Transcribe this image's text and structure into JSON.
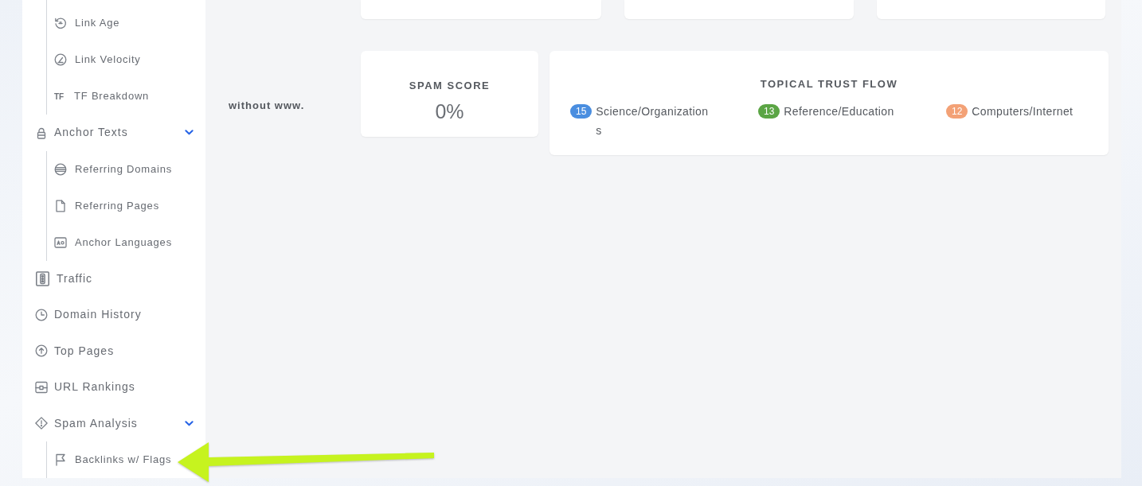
{
  "sidebar": {
    "continued_children": [
      {
        "label": "Link Age"
      },
      {
        "label": "Link Velocity"
      },
      {
        "label": "TF Breakdown",
        "icon_text": "TF"
      }
    ],
    "items": [
      {
        "label": "Anchor Texts",
        "expanded": true,
        "children": [
          {
            "label": "Referring Domains"
          },
          {
            "label": "Referring Pages"
          },
          {
            "label": "Anchor Languages"
          }
        ]
      },
      {
        "label": "Traffic"
      },
      {
        "label": "Domain History"
      },
      {
        "label": "Top Pages"
      },
      {
        "label": "URL Rankings"
      },
      {
        "label": "Spam Analysis",
        "expanded": true,
        "children": [
          {
            "label": "Backlinks w/ Flags"
          }
        ]
      }
    ]
  },
  "main": {
    "row_label": "without www.",
    "spam_score": {
      "title": "SPAM SCORE",
      "value": "0%"
    },
    "topical_trust_flow": {
      "title": "TOPICAL TRUST FLOW",
      "topics": [
        {
          "score": "15",
          "name": "Science/Organizations",
          "color": "#4a8ee0"
        },
        {
          "score": "13",
          "name": "Reference/Education",
          "color": "#5ba545"
        },
        {
          "score": "12",
          "name": "Computers/Internet",
          "color": "#f3a176"
        }
      ]
    }
  },
  "annotations": [
    {
      "kind": "arrow"
    }
  ]
}
